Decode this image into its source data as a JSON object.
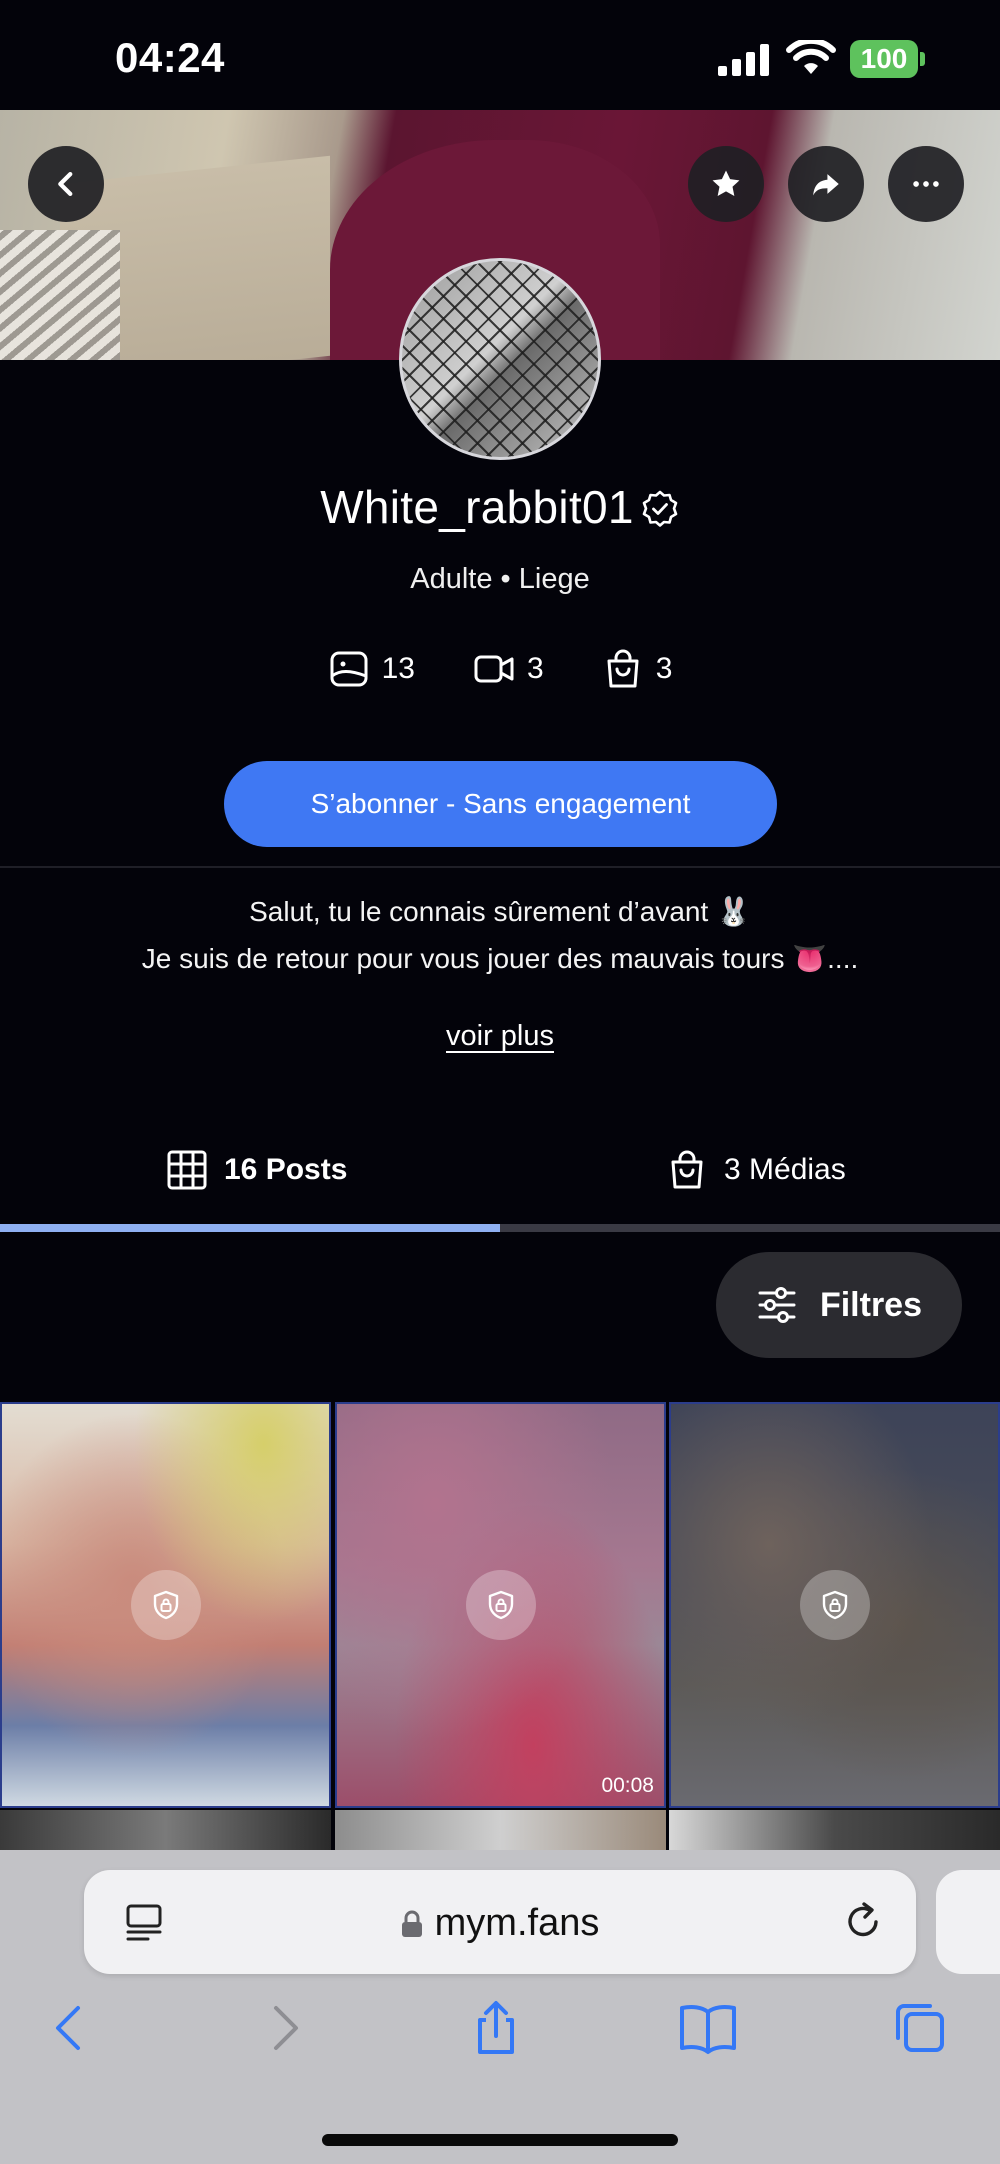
{
  "status_bar": {
    "time": "04:24",
    "battery": "100"
  },
  "profile": {
    "username": "White_rabbit01",
    "subline": "Adulte • Liege",
    "stats": {
      "photos": "13",
      "videos": "3",
      "medias": "3"
    },
    "subscribe_label": "S’abonner - Sans engagement",
    "bio_line1": "Salut, tu le connais sûrement d’avant 🐰",
    "bio_line2": "Je suis de retour pour vous jouer des mauvais tours 👅....",
    "see_more": "voir plus"
  },
  "tabs": {
    "posts": "16 Posts",
    "medias": "3 Médias",
    "active": "posts"
  },
  "filters_label": "Filtres",
  "posts": [
    {
      "locked": true,
      "duration": ""
    },
    {
      "locked": true,
      "duration": "00:08"
    },
    {
      "locked": true,
      "duration": ""
    }
  ],
  "browser": {
    "url": "mym.fans"
  },
  "colors": {
    "accent": "#3f78f3",
    "background": "#03030a",
    "battery": "#5ec25d"
  }
}
